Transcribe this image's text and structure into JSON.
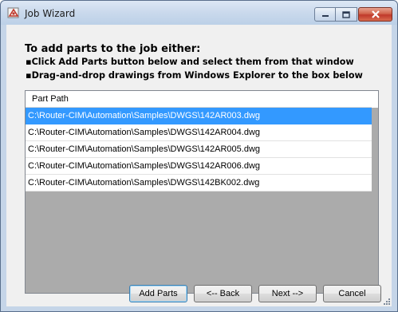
{
  "window": {
    "title": "Job Wizard"
  },
  "content": {
    "heading": "To add parts to the job either:",
    "instructions": [
      "▪Click Add Parts button below and select them from that window",
      "▪Drag-and-drop drawings from Windows Explorer to the box below"
    ]
  },
  "parts_list": {
    "column_header": "Part Path",
    "rows": [
      {
        "path": "C:\\Router-CIM\\Automation\\Samples\\DWGS\\142AR003.dwg",
        "selected": true
      },
      {
        "path": "C:\\Router-CIM\\Automation\\Samples\\DWGS\\142AR004.dwg",
        "selected": false
      },
      {
        "path": "C:\\Router-CIM\\Automation\\Samples\\DWGS\\142AR005.dwg",
        "selected": false
      },
      {
        "path": "C:\\Router-CIM\\Automation\\Samples\\DWGS\\142AR006.dwg",
        "selected": false
      },
      {
        "path": "C:\\Router-CIM\\Automation\\Samples\\DWGS\\142BK002.dwg",
        "selected": false
      }
    ]
  },
  "buttons": {
    "add_parts": "Add Parts",
    "back": "<-- Back",
    "next": "Next -->",
    "cancel": "Cancel"
  },
  "colors": {
    "selection": "#3399ff",
    "list_background": "#ababab",
    "dialog_background": "#f0f0f0"
  }
}
